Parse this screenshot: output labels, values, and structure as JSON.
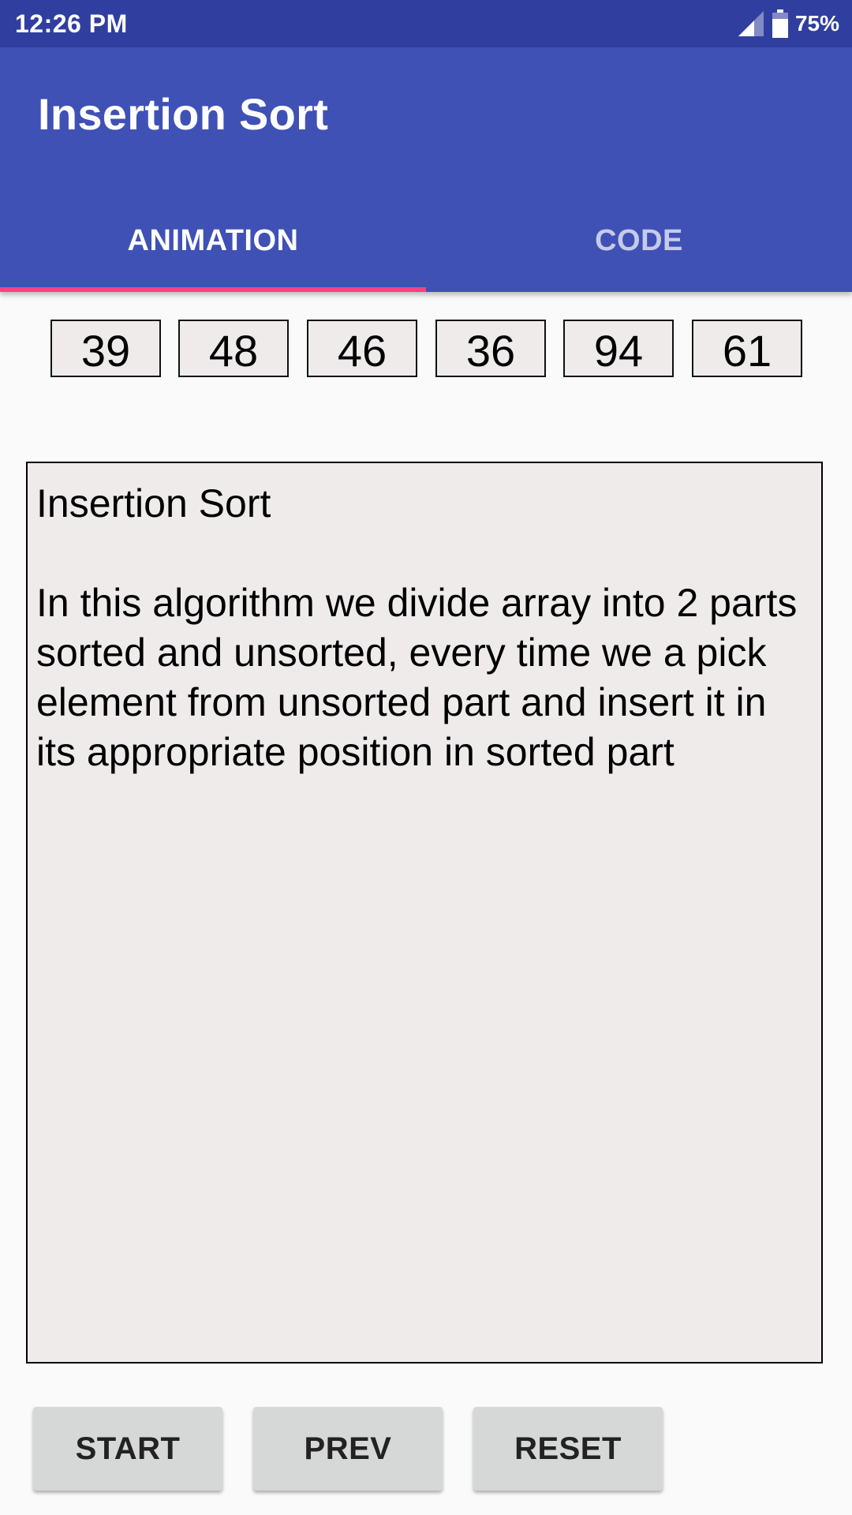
{
  "status_bar": {
    "time": "12:26 PM",
    "battery": "75%",
    "battery_level": 0.75,
    "icons": [
      "signal-icon",
      "battery-icon"
    ]
  },
  "app_bar": {
    "title": "Insertion Sort",
    "tabs": [
      {
        "label": "ANIMATION",
        "active": true
      },
      {
        "label": "CODE",
        "active": false
      }
    ]
  },
  "array": [
    "39",
    "48",
    "46",
    "36",
    "94",
    "61"
  ],
  "description": {
    "title": "Insertion Sort",
    "body": "In this algorithm we divide array into 2 parts sorted and unsorted, every time we a pick element from unsorted part and insert it in its appropriate position in sorted part"
  },
  "buttons": {
    "start": "START",
    "prev": "PREV",
    "reset": "RESET"
  },
  "colors": {
    "status_bar": "#303f9f",
    "primary": "#3f51b5",
    "accent": "#ff4081",
    "box_background": "#efebeb",
    "button": "#d6d7d7"
  }
}
